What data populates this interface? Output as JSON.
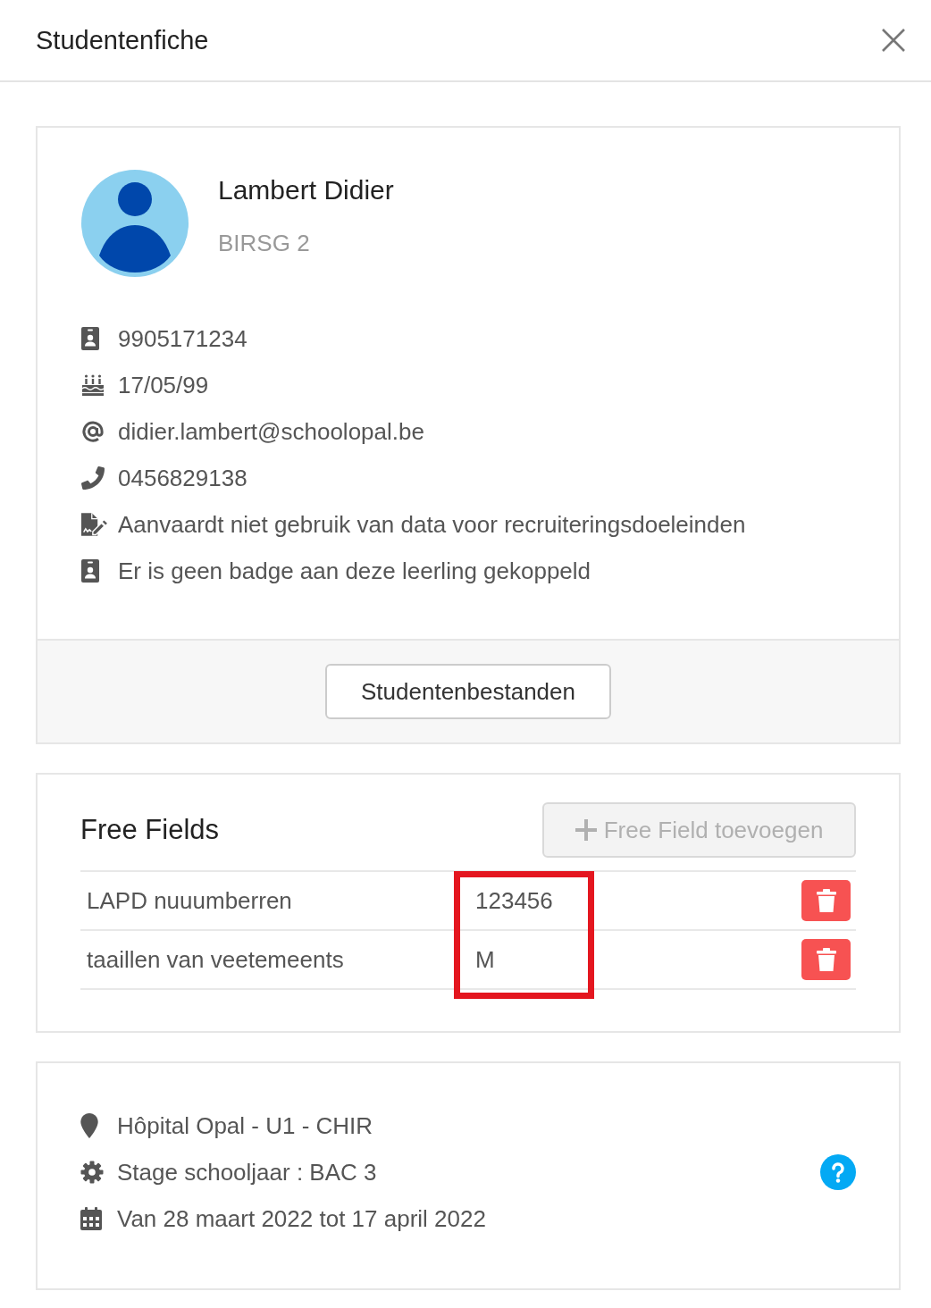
{
  "dialog": {
    "title": "Studentenfiche"
  },
  "profile": {
    "name": "Lambert Didier",
    "subtitle": "BIRSG 2",
    "details": [
      {
        "kind": "id",
        "text": "9905171234"
      },
      {
        "kind": "birthday",
        "text": "17/05/99"
      },
      {
        "kind": "email",
        "text": "didier.lambert@schoolopal.be"
      },
      {
        "kind": "phone",
        "text": "0456829138"
      },
      {
        "kind": "consent",
        "text": "Aanvaardt niet gebruik van data voor recruiteringsdoeleinden"
      },
      {
        "kind": "badge",
        "text": "Er is geen badge aan deze leerling gekoppeld"
      }
    ],
    "files_button": "Studentenbestanden"
  },
  "free_fields": {
    "title": "Free Fields",
    "add_button": {
      "label": "Free Field toevoegen",
      "disabled": true
    },
    "value_column_highlighted": true,
    "rows": [
      {
        "label": "LAPD nuuumberren",
        "value": "123456"
      },
      {
        "label": "taaillen van veetemeents",
        "value": "M"
      }
    ]
  },
  "internship": {
    "details": [
      {
        "kind": "location",
        "text": "Hôpital Opal - U1 - CHIR"
      },
      {
        "kind": "settings",
        "text": "Stage schooljaar : BAC 3"
      },
      {
        "kind": "calendar",
        "text": "Van 28 maart 2022 tot 17 april 2022"
      }
    ]
  }
}
